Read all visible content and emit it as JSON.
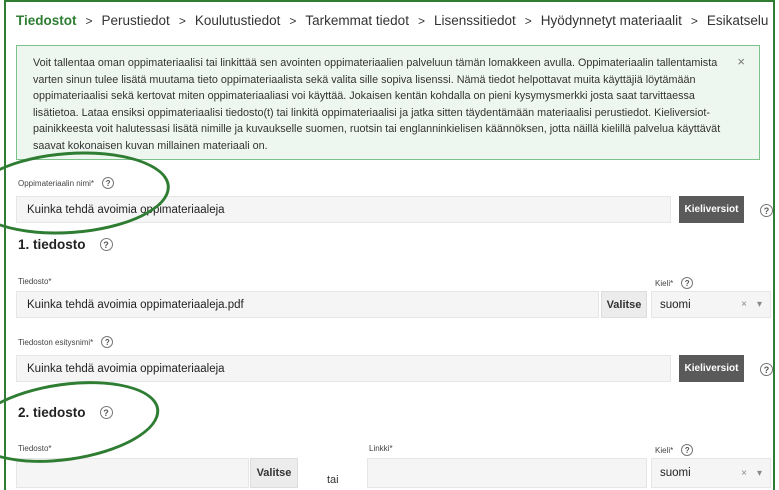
{
  "breadcrumb": {
    "steps": [
      "Tiedostot",
      "Perustiedot",
      "Koulutustiedot",
      "Tarkemmat tiedot",
      "Lisenssitiedot",
      "Hyödynnetyt materiaalit",
      "Esikatselu"
    ],
    "separator": ">"
  },
  "notice": {
    "text": "Voit tallentaa oman oppimateriaalisi tai linkittää sen avointen oppimateriaalien palveluun tämän lomakkeen avulla. Oppimateriaalin tallentamista varten sinun tulee lisätä muutama tieto oppimateriaalista sekä valita sille sopiva lisenssi. Nämä tiedot helpottavat muita käyttäjiä löytämään oppimateriaalisi sekä kertovat miten oppimateriaaliasi voi käyttää. Jokaisen kentän kohdalla on pieni kysymysmerkki josta saat tarvittaessa lisätietoa. Lataa ensiksi oppimateriaalisi tiedosto(t) tai linkitä oppimateriaalisi ja jatka sitten täydentämään materiaalisi perustiedot. Kieliversiot-painikkeesta voit halutessasi lisätä nimille ja kuvaukselle suomen, ruotsin tai englanninkielisen käännöksen, jotta näillä kielillä palvelua käyttävät saavat kokonaisen kuvan millainen materiaali on.",
    "close": "×"
  },
  "material_name": {
    "label": "Oppimateriaalin nimi*",
    "value": "Kuinka tehdä avoimia oppimateriaaleja",
    "lang_button": "Kieliversiot"
  },
  "file1": {
    "heading": "1. tiedosto",
    "file_label": "Tiedosto*",
    "file_value": "Kuinka tehdä avoimia oppimateriaaleja.pdf",
    "choose_button": "Valitse",
    "lang_label": "Kieli*",
    "lang_value": "suomi",
    "display_label": "Tiedoston esitysnimi*",
    "display_value": "Kuinka tehdä avoimia oppimateriaaleja",
    "lang_button": "Kieliversiot"
  },
  "file2": {
    "heading": "2. tiedosto",
    "file_label": "Tiedosto*",
    "choose_button": "Valitse",
    "or_text": "tai",
    "link_label": "Linkki*",
    "lang_label": "Kieli*",
    "lang_value": "suomi"
  },
  "icons": {
    "help": "?",
    "clear": "×",
    "dropdown": "▾"
  },
  "colors": {
    "accent": "#2e7d32",
    "notice_bg": "#eef7ef",
    "notice_border": "#7cc08a",
    "dark_button": "#5a5a5a"
  }
}
